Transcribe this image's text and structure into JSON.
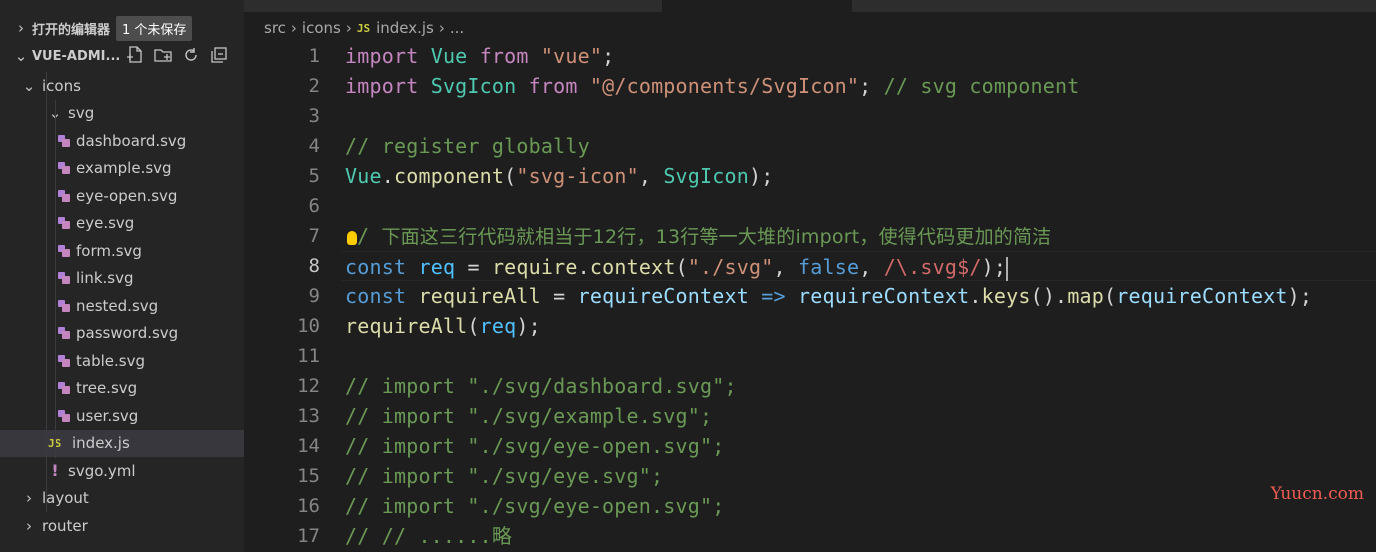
{
  "sidebar": {
    "open_editors": {
      "title": "打开的编辑器",
      "badge": "1 个未保存"
    },
    "root": {
      "title": "VUE-ADMI..."
    },
    "toolbar": [
      "new-file-icon",
      "new-folder-icon",
      "refresh-icon",
      "collapse-all-icon"
    ],
    "tree": [
      {
        "label": "icons",
        "type": "folder",
        "expanded": true,
        "indent": 1
      },
      {
        "label": "svg",
        "type": "folder",
        "expanded": true,
        "indent": 2
      },
      {
        "label": "dashboard.svg",
        "type": "svg",
        "indent": 3
      },
      {
        "label": "example.svg",
        "type": "svg",
        "indent": 3
      },
      {
        "label": "eye-open.svg",
        "type": "svg",
        "indent": 3
      },
      {
        "label": "eye.svg",
        "type": "svg",
        "indent": 3
      },
      {
        "label": "form.svg",
        "type": "svg",
        "indent": 3
      },
      {
        "label": "link.svg",
        "type": "svg",
        "indent": 3
      },
      {
        "label": "nested.svg",
        "type": "svg",
        "indent": 3
      },
      {
        "label": "password.svg",
        "type": "svg",
        "indent": 3
      },
      {
        "label": "table.svg",
        "type": "svg",
        "indent": 3
      },
      {
        "label": "tree.svg",
        "type": "svg",
        "indent": 3
      },
      {
        "label": "user.svg",
        "type": "svg",
        "indent": 3
      },
      {
        "label": "index.js",
        "type": "js",
        "indent": 2,
        "selected": true
      },
      {
        "label": "svgo.yml",
        "type": "yml",
        "indent": 2
      },
      {
        "label": "layout",
        "type": "folder",
        "expanded": false,
        "indent": 1
      },
      {
        "label": "router",
        "type": "folder",
        "expanded": false,
        "indent": 1
      }
    ]
  },
  "breadcrumb": {
    "items": [
      "src",
      "icons",
      "index.js",
      "..."
    ],
    "file_icon": "JS"
  },
  "editor": {
    "active_line": 8,
    "lines": [
      [
        [
          "kw",
          "import"
        ],
        [
          "t",
          " "
        ],
        [
          "cls",
          "Vue"
        ],
        [
          "t",
          " "
        ],
        [
          "kw",
          "from"
        ],
        [
          "t",
          " "
        ],
        [
          "str",
          "\"vue\""
        ],
        [
          "t",
          ";"
        ]
      ],
      [
        [
          "kw",
          "import"
        ],
        [
          "t",
          " "
        ],
        [
          "cls",
          "SvgIcon"
        ],
        [
          "t",
          " "
        ],
        [
          "kw",
          "from"
        ],
        [
          "t",
          " "
        ],
        [
          "str",
          "\"@/components/SvgIcon\""
        ],
        [
          "t",
          "; "
        ],
        [
          "cm",
          "// svg component"
        ]
      ],
      [],
      [
        [
          "cm",
          "// register globally"
        ]
      ],
      [
        [
          "cls",
          "Vue"
        ],
        [
          "t",
          "."
        ],
        [
          "fn",
          "component"
        ],
        [
          "t",
          "("
        ],
        [
          "str",
          "\"svg-icon\""
        ],
        [
          "t",
          ", "
        ],
        [
          "cls",
          "SvgIcon"
        ],
        [
          "t",
          ");"
        ]
      ],
      [],
      [
        [
          "bulb",
          ""
        ],
        [
          "cm",
          "/ "
        ],
        [
          "cmzh",
          "下面这三行代码就相当于12行，13行等一大堆的import，使得代码更加的简洁"
        ]
      ],
      [
        [
          "kb",
          "const"
        ],
        [
          "t",
          " "
        ],
        [
          "vr",
          "req"
        ],
        [
          "t",
          " = "
        ],
        [
          "fn",
          "require"
        ],
        [
          "t",
          "."
        ],
        [
          "fn",
          "context"
        ],
        [
          "t",
          "("
        ],
        [
          "str",
          "\"./svg\""
        ],
        [
          "t",
          ", "
        ],
        [
          "kb",
          "false"
        ],
        [
          "t",
          ", "
        ],
        [
          "rx",
          "/\\.svg$/"
        ],
        [
          "t",
          ");"
        ],
        [
          "cursor",
          ""
        ]
      ],
      [
        [
          "kb",
          "const"
        ],
        [
          "t",
          " "
        ],
        [
          "fn",
          "requireAll"
        ],
        [
          "t",
          " = "
        ],
        [
          "pa",
          "requireContext"
        ],
        [
          "t",
          " "
        ],
        [
          "kb",
          "=>"
        ],
        [
          "t",
          " "
        ],
        [
          "pa",
          "requireContext"
        ],
        [
          "t",
          "."
        ],
        [
          "fn",
          "keys"
        ],
        [
          "t",
          "()."
        ],
        [
          "fn",
          "map"
        ],
        [
          "t",
          "("
        ],
        [
          "pa",
          "requireContext"
        ],
        [
          "t",
          ");"
        ]
      ],
      [
        [
          "fn",
          "requireAll"
        ],
        [
          "t",
          "("
        ],
        [
          "vr",
          "req"
        ],
        [
          "t",
          ");"
        ]
      ],
      [],
      [
        [
          "cm",
          "// import \"./svg/dashboard.svg\";"
        ]
      ],
      [
        [
          "cm",
          "// import \"./svg/example.svg\";"
        ]
      ],
      [
        [
          "cm",
          "// import \"./svg/eye-open.svg\";"
        ]
      ],
      [
        [
          "cm",
          "// import \"./svg/eye.svg\";"
        ]
      ],
      [
        [
          "cm",
          "// import \"./svg/eye-open.svg\";"
        ]
      ],
      [
        [
          "cm",
          "// // ......略"
        ]
      ]
    ]
  },
  "watermark": "Yuucn.com"
}
